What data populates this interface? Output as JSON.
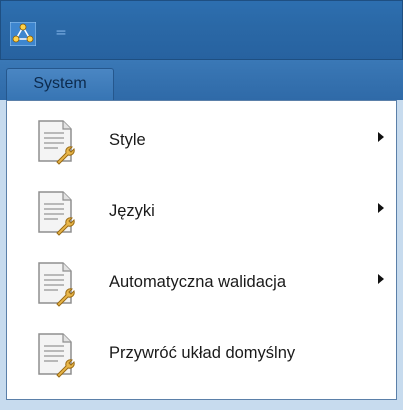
{
  "toolbar": {
    "app_icon": "network-app-icon",
    "dropdown_glyph": "="
  },
  "tabs": [
    {
      "label": "System",
      "active": true
    }
  ],
  "menu": {
    "items": [
      {
        "label": "Style",
        "icon": "document-wrench-icon",
        "has_submenu": true
      },
      {
        "label": "Języki",
        "icon": "document-wrench-icon",
        "has_submenu": true
      },
      {
        "label": "Automatyczna walidacja",
        "icon": "document-wrench-icon",
        "has_submenu": true
      },
      {
        "label": "Przywróć układ domyślny",
        "icon": "document-wrench-icon",
        "has_submenu": false
      }
    ]
  },
  "colors": {
    "titlebar": "#2a68a6",
    "tab": "#3775b4",
    "menu_bg": "#ffffff",
    "menu_border": "#5b80a9",
    "text": "#1a1a1a"
  }
}
